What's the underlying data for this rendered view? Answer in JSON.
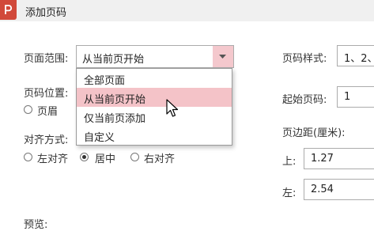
{
  "window": {
    "title": "添加页码"
  },
  "range": {
    "label": "页面范围:",
    "selected": "从当前页开始",
    "options": [
      "全部页面",
      "从当前页开始",
      "仅当前页添加",
      "自定义"
    ]
  },
  "position": {
    "label": "页码位置:",
    "options": [
      "页眉"
    ]
  },
  "align": {
    "label": "对齐方式:",
    "options": [
      "左对齐",
      "居中",
      "右对齐"
    ],
    "selected": "居中"
  },
  "style": {
    "label": "页码样式:",
    "value": "1、2、"
  },
  "start": {
    "label": "起始页码:",
    "value": "1"
  },
  "margin": {
    "label": "页边距(厘米):",
    "top_label": "上:",
    "top_value": "1.27",
    "left_label": "左:",
    "left_value": "2.54"
  },
  "preview": {
    "label": "预览:"
  },
  "colors": {
    "accent": "#d1493a",
    "highlight": "#f4c3c8"
  }
}
